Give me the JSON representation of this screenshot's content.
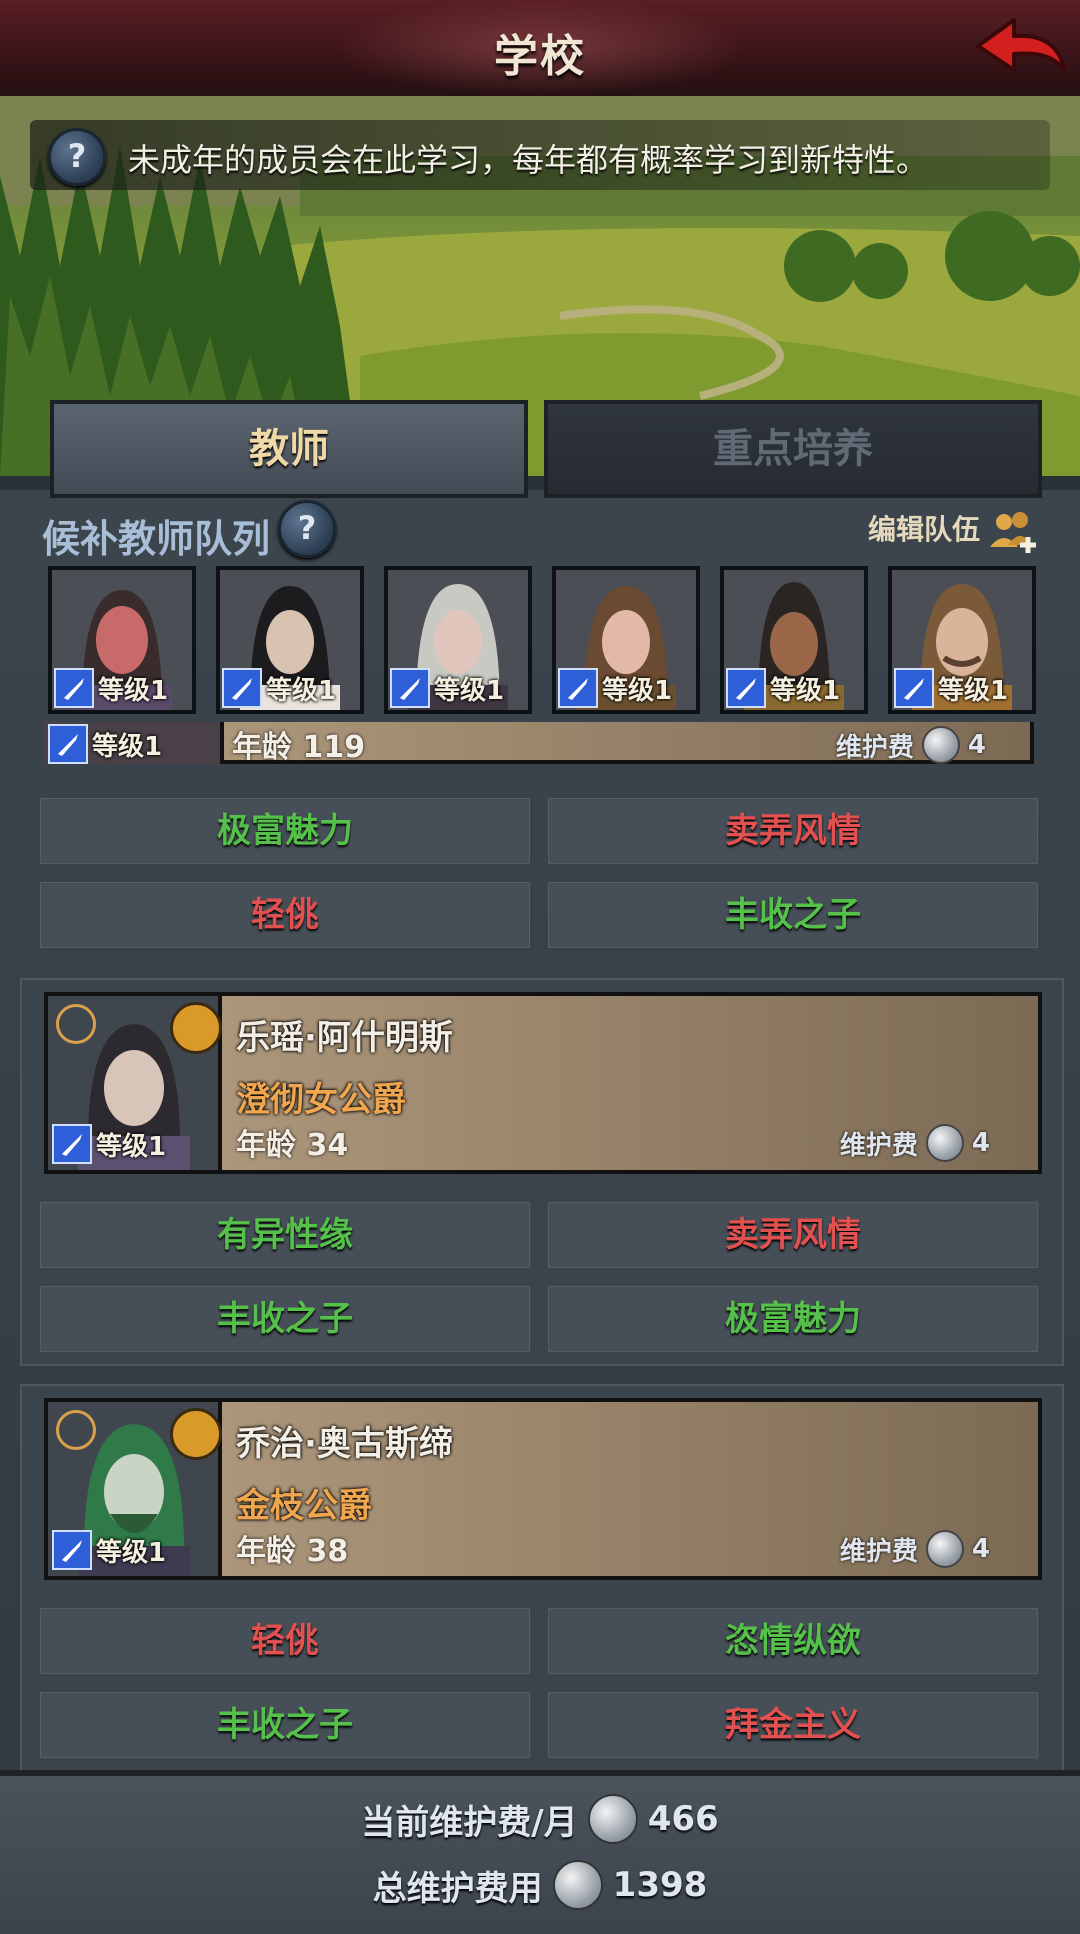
{
  "header": {
    "title": "学校"
  },
  "info": {
    "text": "未成年的成员会在此学习，每年都有概率学习到新特性。",
    "help_icon": "?"
  },
  "tabs": [
    {
      "label": "教师",
      "active": true
    },
    {
      "label": "重点培养",
      "active": false
    }
  ],
  "queue": {
    "label": "候补教师队列",
    "help_icon": "?",
    "edit_label": "编辑队伍"
  },
  "level_text": "等级1",
  "candidates": [
    {
      "level": "等级1"
    },
    {
      "level": "等级1"
    },
    {
      "level": "等级1"
    },
    {
      "level": "等级1"
    },
    {
      "level": "等级1"
    },
    {
      "level": "等级1"
    }
  ],
  "teachers": [
    {
      "name": "",
      "title": "",
      "level": "等级1",
      "age_label": "年龄",
      "age": "119",
      "upkeep_label": "维护费",
      "upkeep": "4",
      "traits": [
        {
          "label": "极富魅力",
          "color": "#55c04a"
        },
        {
          "label": "卖弄风情",
          "color": "#e35050"
        },
        {
          "label": "轻佻",
          "color": "#e35050"
        },
        {
          "label": "丰收之子",
          "color": "#55c04a"
        }
      ]
    },
    {
      "name": "乐瑶·阿什明斯",
      "title": "澄彻女公爵",
      "level": "等级1",
      "age_label": "年龄",
      "age": "34",
      "upkeep_label": "维护费",
      "upkeep": "4",
      "traits": [
        {
          "label": "有异性缘",
          "color": "#55c04a"
        },
        {
          "label": "卖弄风情",
          "color": "#e35050"
        },
        {
          "label": "丰收之子",
          "color": "#55c04a"
        },
        {
          "label": "极富魅力",
          "color": "#55c04a"
        }
      ]
    },
    {
      "name": "乔治·奥古斯缔",
      "title": "金枝公爵",
      "level": "等级1",
      "age_label": "年龄",
      "age": "38",
      "upkeep_label": "维护费",
      "upkeep": "4",
      "traits": [
        {
          "label": "轻佻",
          "color": "#e35050"
        },
        {
          "label": "恣情纵欲",
          "color": "#55c04a"
        },
        {
          "label": "丰收之子",
          "color": "#55c04a"
        },
        {
          "label": "拜金主义",
          "color": "#e35050"
        }
      ]
    }
  ],
  "footer": {
    "monthly_label": "当前维护费/月",
    "monthly_value": "466",
    "total_label": "总维护费用",
    "total_value": "1398"
  },
  "icons": {
    "back": "back-arrow-icon",
    "coin": "silver-coin-icon",
    "sword": "sword-icon",
    "team": "team-add-icon",
    "rotate": "swap-icon"
  }
}
